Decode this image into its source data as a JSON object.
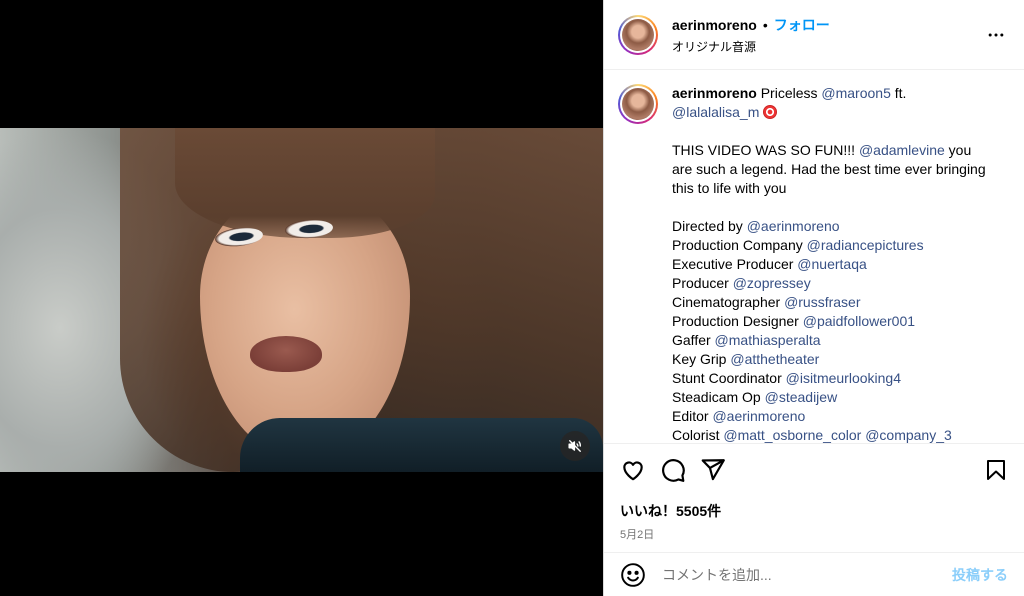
{
  "header": {
    "username": "aerinmoreno",
    "separator": "•",
    "follow_label": "フォロー",
    "audio_label": "オリジナル音源",
    "more_icon": "more-horizontal-icon"
  },
  "caption": {
    "username": "aerinmoreno",
    "title_text": "Priceless",
    "mention_1": "@maroon5",
    "ft_text": "ft.",
    "mention_2": "@lalalalisa_m",
    "para1_text": "THIS VIDEO WAS SO FUN!!!",
    "para1_mention": "@adamlevine",
    "para1_rest": "you are such a legend. Had the best time ever bringing this to life with you",
    "credits": [
      {
        "role": "Directed by",
        "handle": "@aerinmoreno"
      },
      {
        "role": "Production Company",
        "handle": "@radiancepictures"
      },
      {
        "role": "Executive Producer",
        "handle": "@nuertaqa"
      },
      {
        "role": "Producer",
        "handle": "@zopressey"
      },
      {
        "role": "Cinematographer",
        "handle": "@russfraser"
      },
      {
        "role": "Production Designer",
        "handle": "@paidfollower001"
      },
      {
        "role": "Gaffer",
        "handle": "@mathiasperalta"
      },
      {
        "role": "Key Grip",
        "handle": "@atthetheater"
      },
      {
        "role": "Stunt Coordinator",
        "handle": "@isitmeurlooking4"
      },
      {
        "role": "Steadicam Op",
        "handle": "@steadijew"
      },
      {
        "role": "Editor",
        "handle": "@aerinmoreno"
      },
      {
        "role": "Colorist",
        "handle": "@matt_osborne_color @company_3"
      }
    ]
  },
  "actions": {
    "like_icon": "heart-icon",
    "comment_icon": "comment-icon",
    "share_icon": "share-icon",
    "save_icon": "bookmark-icon",
    "likes_text": "いいね！5505件",
    "date_text": "5月2日"
  },
  "comment_bar": {
    "emoji_icon": "emoji-icon",
    "placeholder": "コメントを追加...",
    "post_label": "投稿する"
  },
  "media": {
    "mute_icon": "speaker-muted-icon"
  }
}
